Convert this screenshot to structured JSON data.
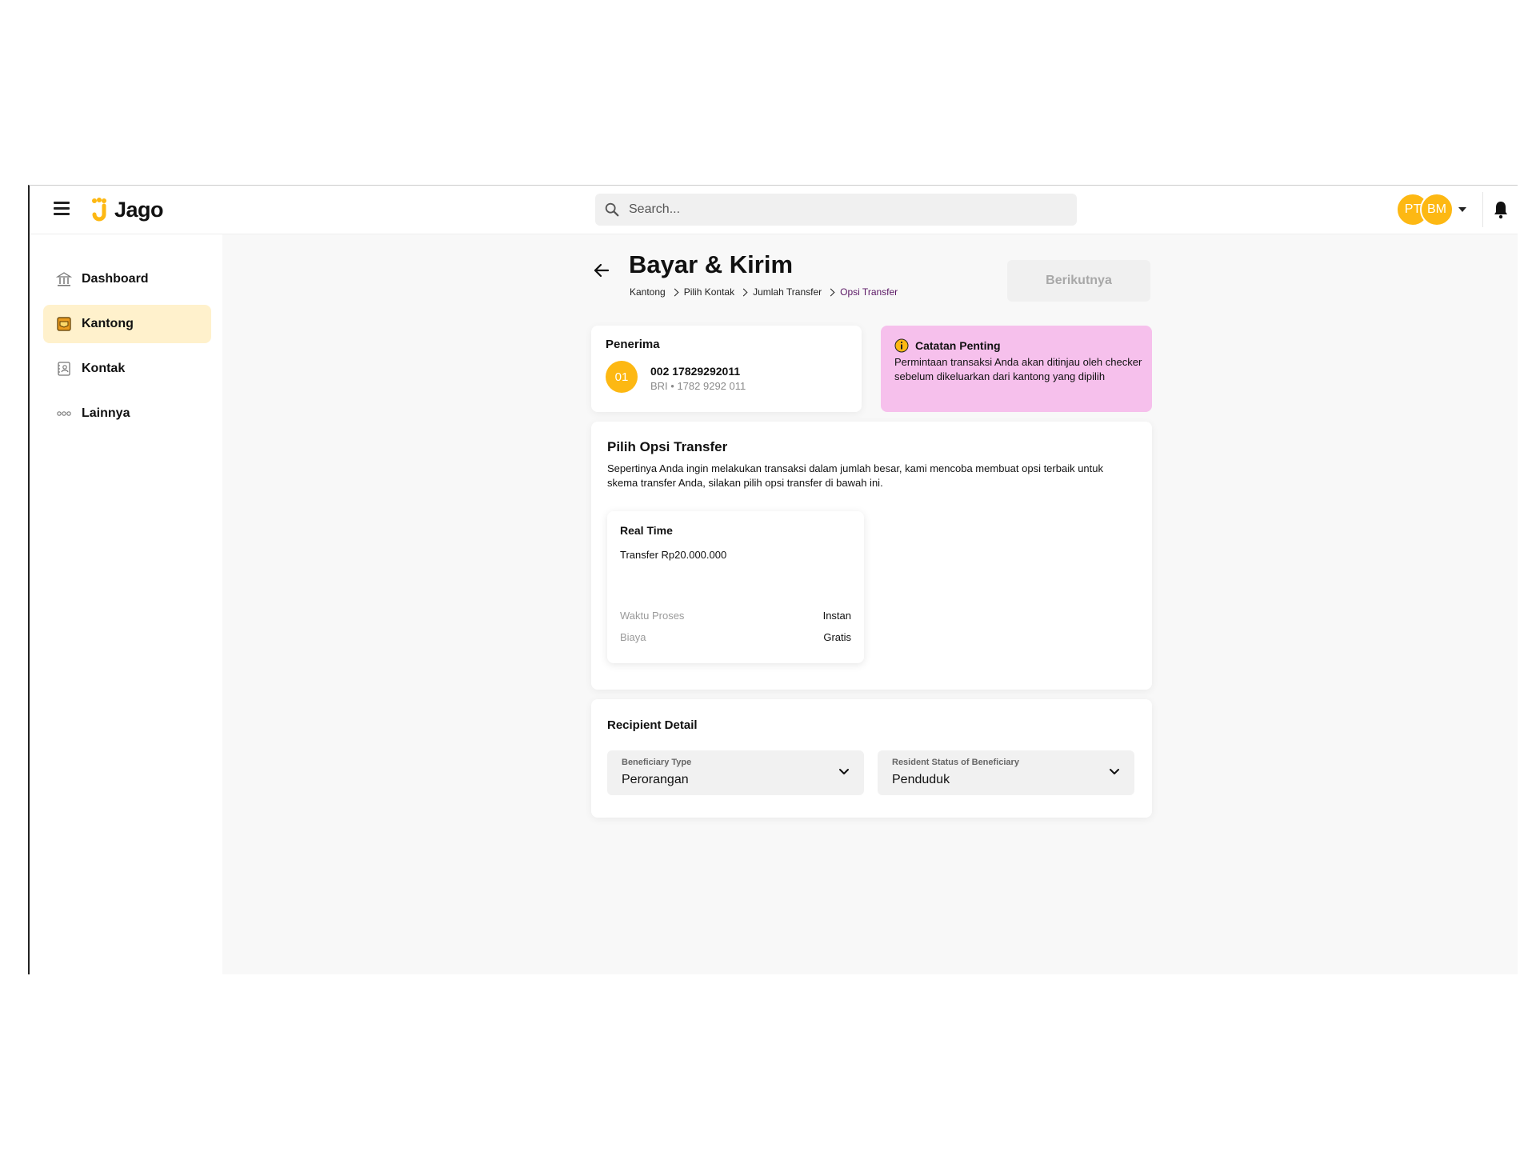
{
  "app": {
    "logo_text": "Jago"
  },
  "search": {
    "placeholder": "Search..."
  },
  "user": {
    "avatar_1": "PT",
    "avatar_2": "BM"
  },
  "sidebar": {
    "items": [
      {
        "label": "Dashboard",
        "icon": "bank-icon"
      },
      {
        "label": "Kantong",
        "icon": "pocket-icon",
        "active": true
      },
      {
        "label": "Kontak",
        "icon": "contact-book-icon"
      },
      {
        "label": "Lainnya",
        "icon": "more-dots-icon"
      }
    ]
  },
  "page": {
    "title": "Bayar & Kirim",
    "next_label": "Berikutnya",
    "breadcrumb": [
      "Kantong",
      "Pilih Kontak",
      "Jumlah Transfer",
      "Opsi Transfer"
    ]
  },
  "recipient": {
    "label": "Penerima",
    "badge": "01",
    "account_number": "002 17829292011",
    "account_sub": "BRI • 1782 9292 011"
  },
  "note": {
    "title": "Catatan Penting",
    "text": "Permintaan transaksi Anda akan ditinjau oleh checker sebelum dikeluarkan dari kantong yang dipilih"
  },
  "transfer_options": {
    "title": "Pilih Opsi Transfer",
    "description": "Sepertinya Anda ingin melakukan transaksi dalam jumlah besar, kami mencoba membuat opsi terbaik untuk skema transfer Anda, silakan pilih opsi transfer di bawah ini.",
    "option": {
      "title": "Real Time",
      "amount": "Transfer Rp20.000.000",
      "process_label": "Waktu Proses",
      "process_value": "Instan",
      "fee_label": "Biaya",
      "fee_value": "Gratis"
    }
  },
  "recipient_detail": {
    "title": "Recipient Detail",
    "beneficiary_type_label": "Beneficiary Type",
    "beneficiary_type_value": "Perorangan",
    "resident_status_label": "Resident Status of Beneficiary",
    "resident_status_value": "Penduduk"
  },
  "colors": {
    "brand_yellow": "#fdb813",
    "active_nav_bg": "#fff1cc",
    "note_bg": "#f6c0ec",
    "breadcrumb_current": "#5a1764"
  }
}
